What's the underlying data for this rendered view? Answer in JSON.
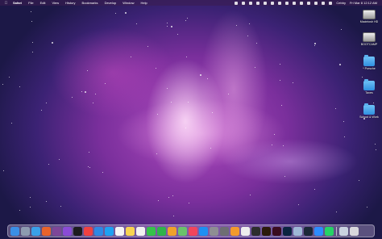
{
  "menubar": {
    "apple_icon": "apple-logo",
    "app_name": "Safari",
    "menus": [
      "File",
      "Edit",
      "View",
      "History",
      "Bookmarks",
      "Develop",
      "Window",
      "Help"
    ],
    "status_icons": [
      "status-icon-1",
      "status-icon-2",
      "status-icon-3",
      "status-icon-4",
      "status-icon-5",
      "status-icon-6",
      "status-icon-7",
      "status-icon-8",
      "status-icon-9",
      "status-icon-10",
      "status-icon-11",
      "status-icon-12",
      "status-icon-13",
      "status-icon-14"
    ],
    "wifi_text": "Cebby",
    "clock": "Fri Mar 8  12:12 AM"
  },
  "desktop_icons": [
    {
      "label": "Macintosh HD",
      "type": "drive"
    },
    {
      "label": "BOOTCAMP",
      "type": "drive"
    },
    {
      "label": "* Porsche",
      "type": "folder"
    },
    {
      "label": "Taxes",
      "type": "folder"
    },
    {
      "label": "School & Work",
      "type": "folder"
    }
  ],
  "dock": {
    "apps": [
      {
        "name": "finder",
        "color": "#3b8fe6"
      },
      {
        "name": "launchpad",
        "color": "#8d9bb0"
      },
      {
        "name": "safari",
        "color": "#3aa0e8"
      },
      {
        "name": "firefox",
        "color": "#e8632b"
      },
      {
        "name": "tor-browser",
        "color": "#7d4698"
      },
      {
        "name": "twitch",
        "color": "#8a4bd6"
      },
      {
        "name": "apple-tv",
        "color": "#1c1c1e"
      },
      {
        "name": "news",
        "color": "#f04141"
      },
      {
        "name": "mail",
        "color": "#2d89e5"
      },
      {
        "name": "twitter",
        "color": "#1da1f2"
      },
      {
        "name": "calendar",
        "color": "#f5f5f5"
      },
      {
        "name": "notes",
        "color": "#f7d451"
      },
      {
        "name": "reminders",
        "color": "#f2f2f2"
      },
      {
        "name": "messages",
        "color": "#36c24a"
      },
      {
        "name": "facetime",
        "color": "#2fb34a"
      },
      {
        "name": "photos",
        "color": "#f0a12b"
      },
      {
        "name": "maps",
        "color": "#6ac26b"
      },
      {
        "name": "music",
        "color": "#f1455c"
      },
      {
        "name": "app-store",
        "color": "#1d8ff2"
      },
      {
        "name": "system-preferences",
        "color": "#8e8e93"
      },
      {
        "name": "screenshot",
        "color": "#6e6e73"
      },
      {
        "name": "pages",
        "color": "#f29a2c"
      },
      {
        "name": "textedit",
        "color": "#ededed"
      },
      {
        "name": "final-cut-pro",
        "color": "#2d2d2d"
      },
      {
        "name": "illustrator",
        "color": "#2b1a0b"
      },
      {
        "name": "indesign",
        "color": "#3a0c1f"
      },
      {
        "name": "photoshop",
        "color": "#0b2440"
      },
      {
        "name": "preview",
        "color": "#9fb7d6"
      },
      {
        "name": "steam",
        "color": "#1b2838"
      },
      {
        "name": "zoom",
        "color": "#2d8cff"
      },
      {
        "name": "whatsapp",
        "color": "#25d366"
      },
      {
        "name": "downloads-stack",
        "color": "#c9d2e0"
      },
      {
        "name": "trash",
        "color": "#d8d8dc"
      }
    ]
  }
}
